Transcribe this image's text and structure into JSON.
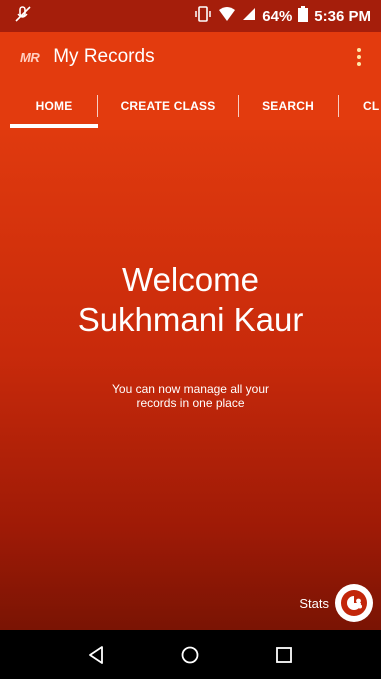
{
  "status_bar": {
    "battery": "64%",
    "time": "5:36 PM",
    "icons": [
      "mic-off-icon",
      "vibrate-icon",
      "wifi-icon",
      "signal-icon",
      "battery-icon"
    ]
  },
  "app_bar": {
    "logo": "MR",
    "title": "My Records",
    "menu_icon": "overflow-menu-icon"
  },
  "tabs": [
    {
      "label": "HOME",
      "selected": true
    },
    {
      "label": "CREATE CLASS",
      "selected": false
    },
    {
      "label": "SEARCH",
      "selected": false
    },
    {
      "label": "CL",
      "selected": false
    }
  ],
  "main": {
    "welcome_line1": "Welcome",
    "welcome_line2": "Sukhmani Kaur",
    "subtitle": "You can now manage all your records in one place",
    "stats_label": "Stats",
    "stats_icon": "stats-icon"
  },
  "nav_bar": {
    "icons": [
      "back-icon",
      "home-icon",
      "recents-icon"
    ]
  },
  "colors": {
    "status_bar": "#a51e0b",
    "app_bar": "#e33b0e",
    "gradient_top": "#e03a0e",
    "gradient_bottom": "#7a1404"
  }
}
